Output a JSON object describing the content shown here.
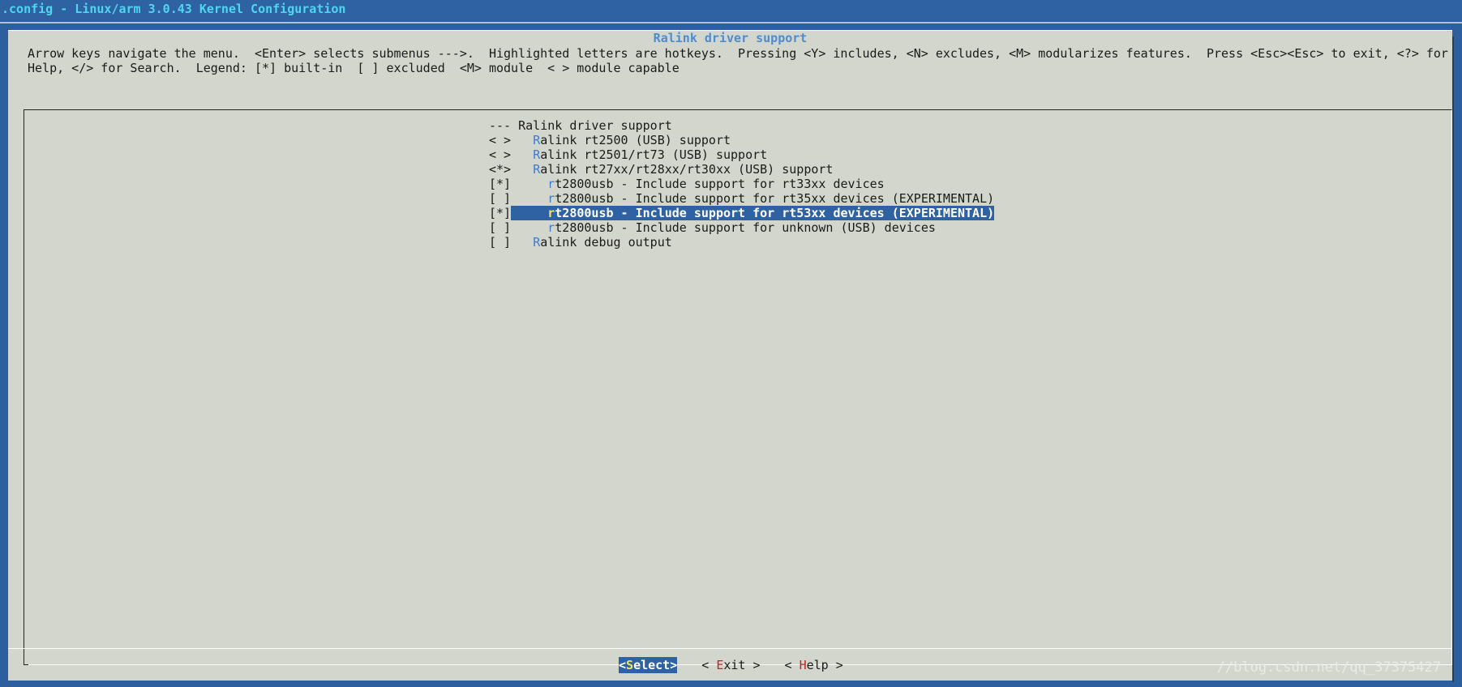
{
  "window": {
    "title": ".config - Linux/arm 3.0.43 Kernel Configuration"
  },
  "menu": {
    "title": "Ralink driver support",
    "help_line_1": "Arrow keys navigate the menu.  <Enter> selects submenus --->.  Highlighted letters are hotkeys.  Pressing <Y> includes, <N> excludes, <M> modularizes features.  Press <Esc><Esc> to exit, <?> for",
    "help_line_2": "Help, </> for Search.  Legend: [*] built-in  [ ] excluded  <M> module  < > module capable"
  },
  "items": [
    {
      "prefix": "--- ",
      "hotkey": "",
      "label": "Ralink driver support"
    },
    {
      "prefix": "< >   ",
      "hotkey": "R",
      "label": "alink rt2500 (USB) support"
    },
    {
      "prefix": "< >   ",
      "hotkey": "R",
      "label": "alink rt2501/rt73 (USB) support"
    },
    {
      "prefix": "<*>   ",
      "hotkey": "R",
      "label": "alink rt27xx/rt28xx/rt30xx (USB) support"
    },
    {
      "prefix": "[*]     ",
      "hotkey": "r",
      "label": "t2800usb - Include support for rt33xx devices"
    },
    {
      "prefix": "[ ]     ",
      "hotkey": "r",
      "label": "t2800usb - Include support for rt35xx devices (EXPERIMENTAL)"
    },
    {
      "mark": "[*]",
      "prefix": "     ",
      "hotkey": "r",
      "label": "t2800usb - Include support for rt53xx devices (EXPERIMENTAL)",
      "selected": true
    },
    {
      "prefix": "[ ]     ",
      "hotkey": "r",
      "label": "t2800usb - Include support for unknown (USB) devices"
    },
    {
      "prefix": "[ ]   ",
      "hotkey": "R",
      "label": "alink debug output"
    }
  ],
  "buttons": {
    "select": {
      "open": "<",
      "hotkey": "S",
      "rest": "elect>"
    },
    "exit": {
      "open": "< ",
      "hotkey": "E",
      "rest": "xit >"
    },
    "help": {
      "open": "< ",
      "hotkey": "H",
      "rest": "elp >"
    }
  },
  "watermark": "//blog.csdn.net/qq_37375427"
}
